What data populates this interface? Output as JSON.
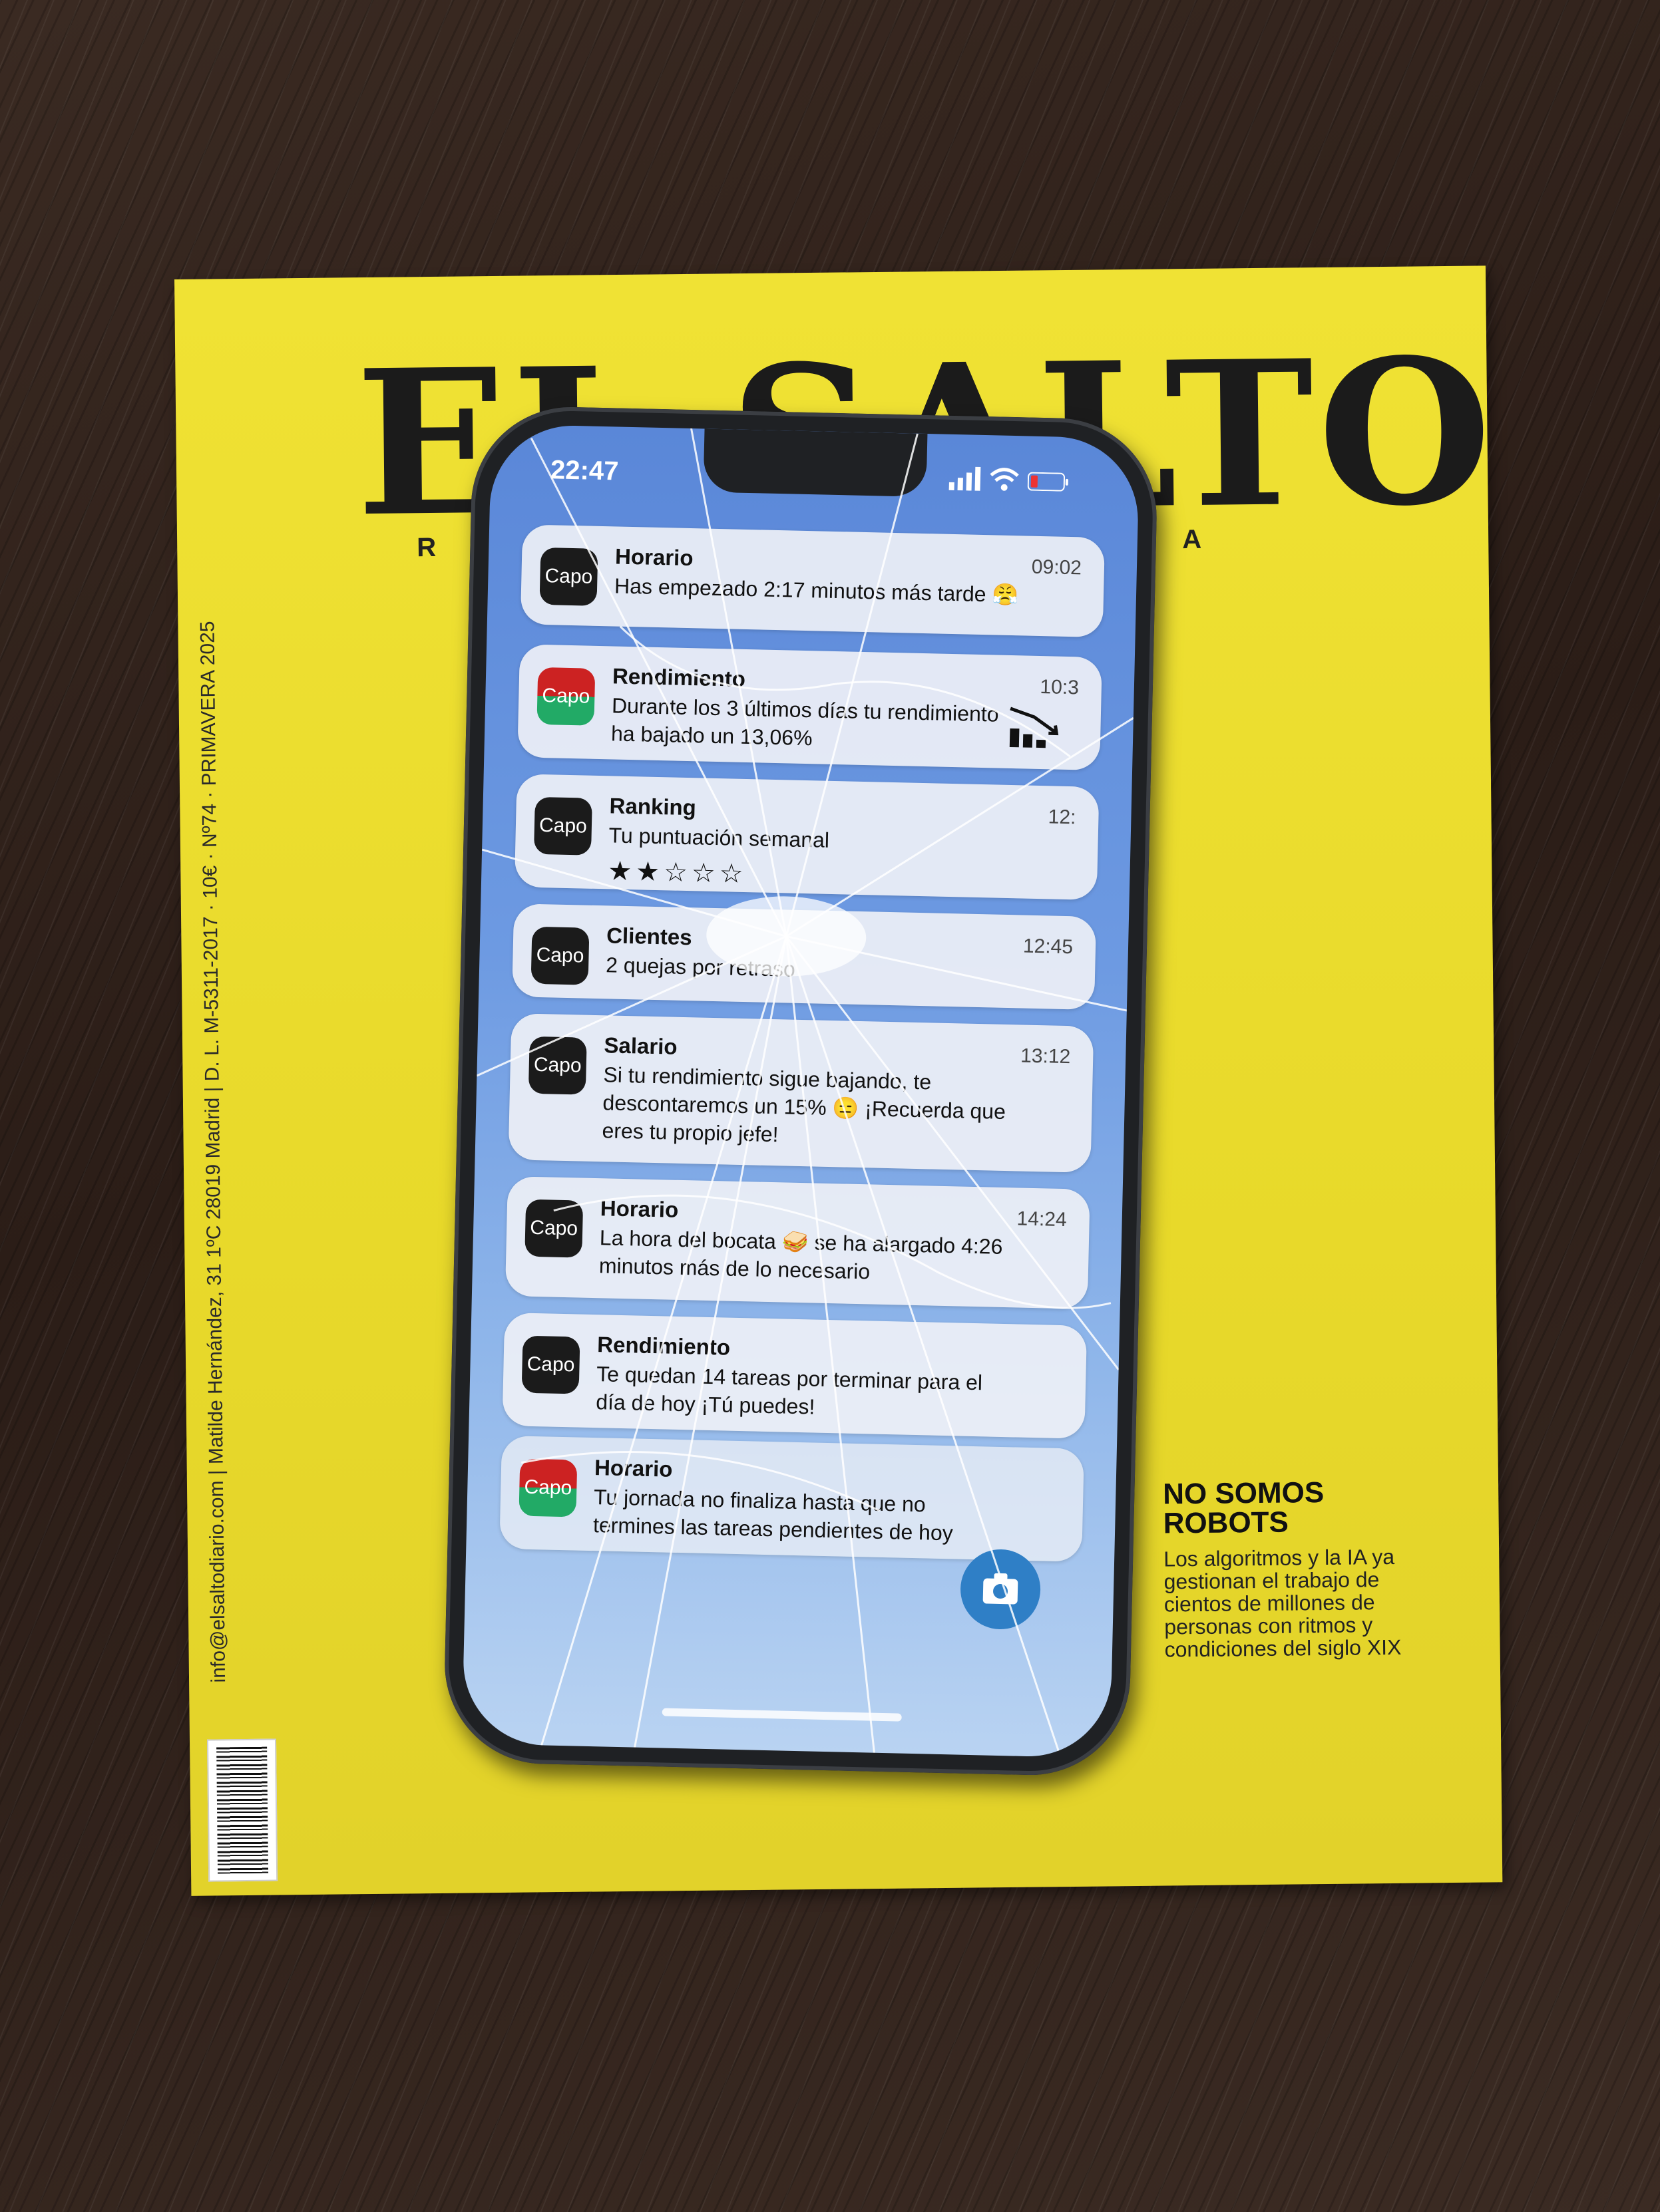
{
  "magazine": {
    "masthead": "EL SALTO",
    "sub_left": "R",
    "sub_right": "A",
    "spine": "info@elsaltodiario.com | Matilde Hernández, 31 1ºC 28019 Madrid | D. L. M-5311-2017 · 10€ · Nº74 · PRIMAVERA 2025",
    "feature_title": "NO SOMOS\nROBOTS",
    "feature_text": "Los algoritmos y la IA ya gestionan el trabajo de cientos de millones de personas con ritmos y condiciones del siglo XIX"
  },
  "phone": {
    "status_time": "22:47",
    "app_icon_label": "Capo",
    "notifications": [
      {
        "title": "Horario",
        "time": "09:02",
        "body": "Has empezado 2:17 minutos más tarde 😤"
      },
      {
        "title": "Rendimiento",
        "time": "10:3",
        "body": "Durante los 3 últimos días tu rendimiento ha bajado un 13,06%"
      },
      {
        "title": "Ranking",
        "time": "12:",
        "body": "Tu puntuación semanal",
        "stars": "★★☆☆☆"
      },
      {
        "title": "Clientes",
        "time": "12:45",
        "body": "2 quejas por retraso"
      },
      {
        "title": "Salario",
        "time": "13:12",
        "body": "Si tu rendimiento sigue bajando, te descontaremos un 15% 😑 ¡Recuerda que eres tu propio jefe!"
      },
      {
        "title": "Horario",
        "time": "14:24",
        "body": "La hora del bocata 🥪 se ha alargado 4:26 minutos más de lo necesario"
      },
      {
        "title": "Rendimiento",
        "time": "",
        "body": "Te quedan 14 tareas por terminar para el día de hoy ¡Tú puedes!"
      },
      {
        "title": "Horario",
        "time": "",
        "body": "Tu jornada no finaliza hasta que no termines las tareas pendientes de hoy"
      }
    ]
  },
  "colors": {
    "magazine_yellow": "#ebdc2c",
    "wood": "#2f211a",
    "screen_blue": "#6d9ae2",
    "camera_blue": "#2f7fc6"
  }
}
